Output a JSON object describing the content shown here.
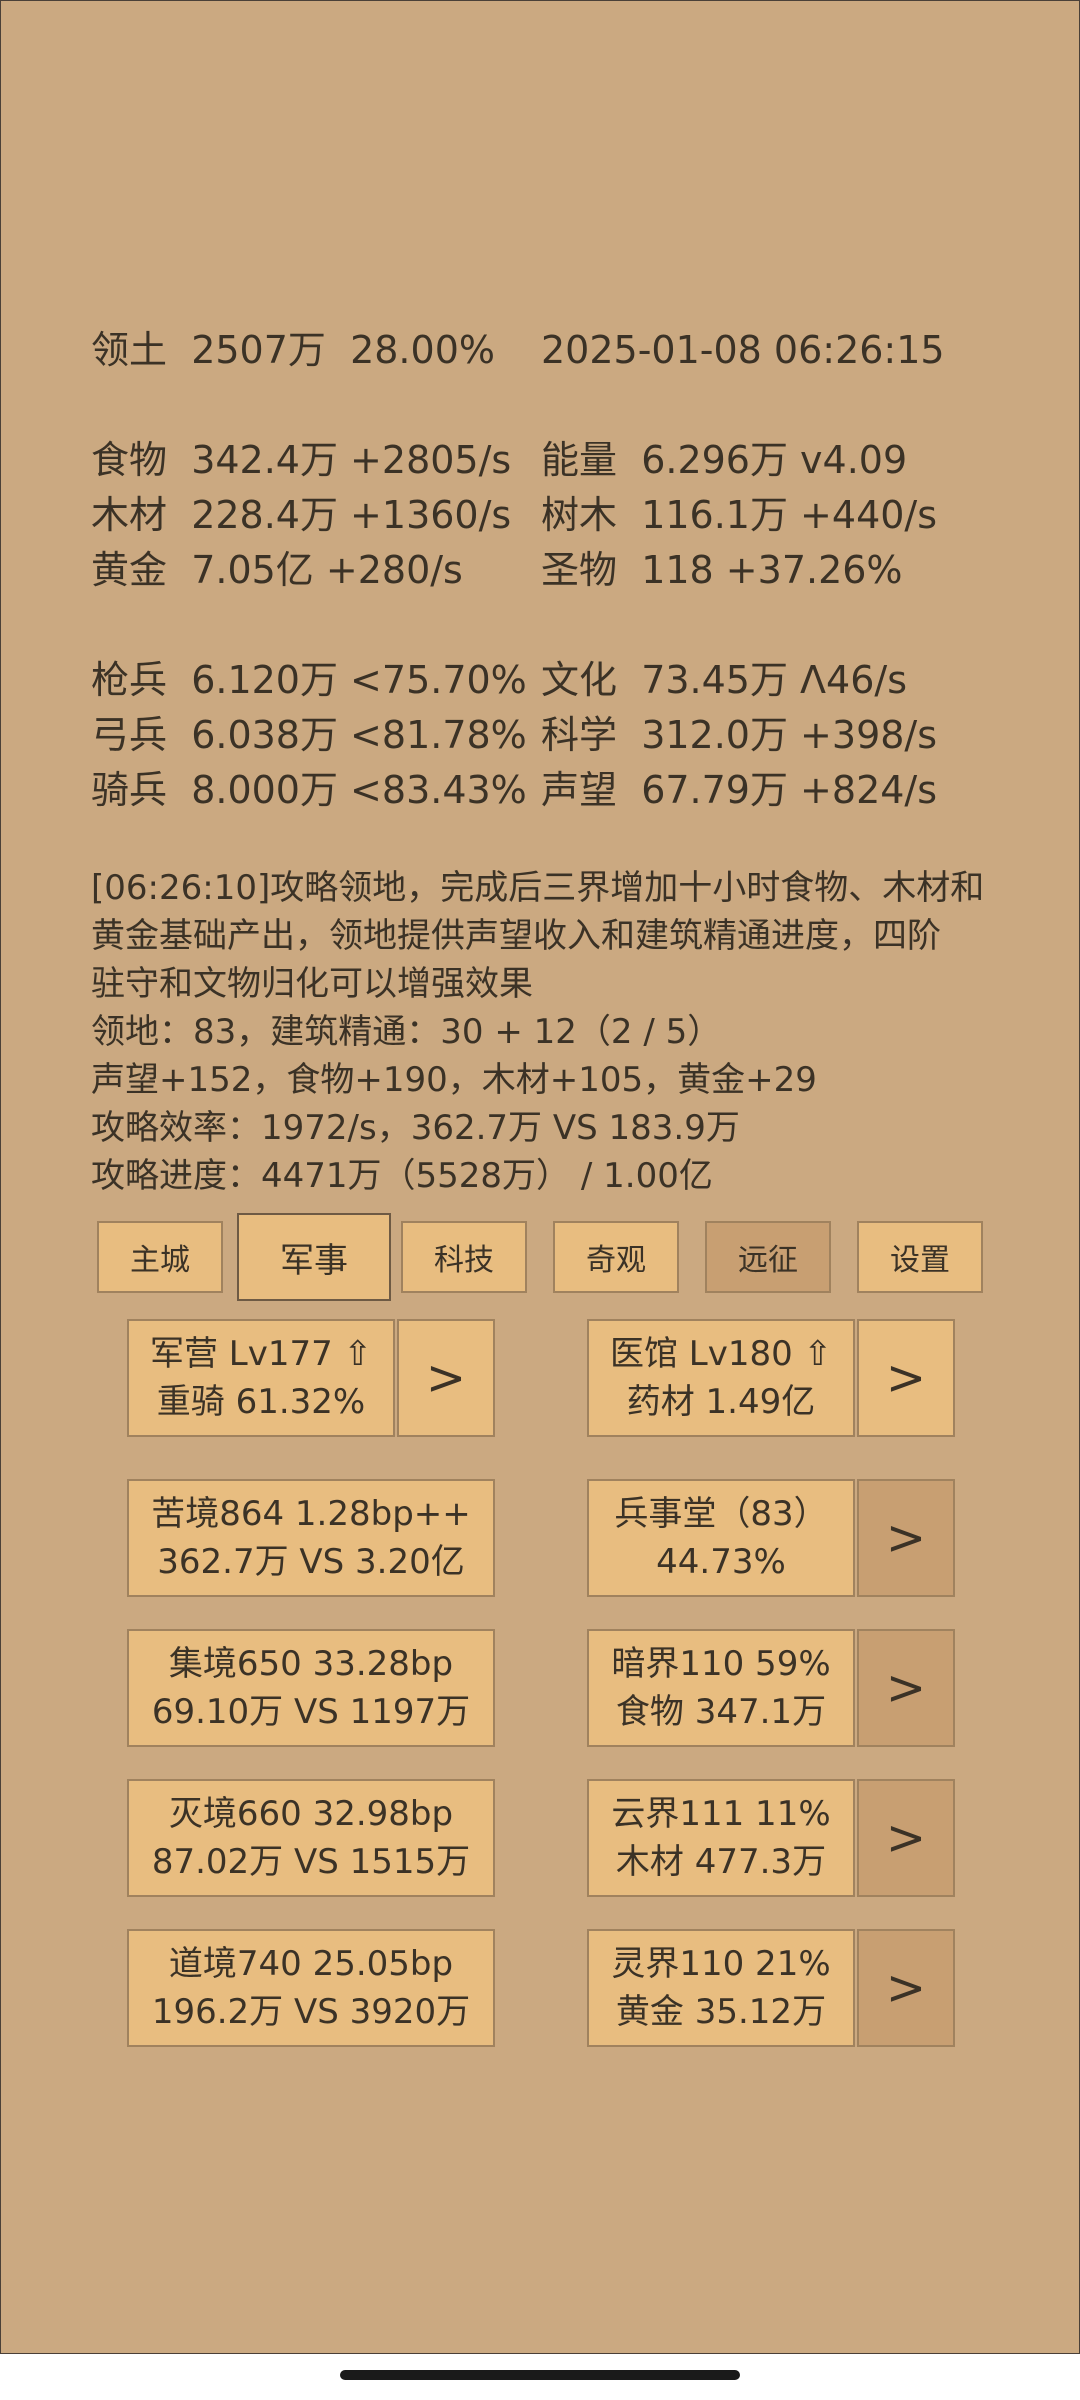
{
  "stats": {
    "territory": {
      "label": "领土",
      "value": "2507万",
      "pct": "28.00%"
    },
    "datetime": "2025-01-08 06:26:15",
    "left": [
      {
        "label": "食物",
        "value": "342.4万 +2805/s"
      },
      {
        "label": "木材",
        "value": "228.4万 +1360/s"
      },
      {
        "label": "黄金",
        "value": "7.05亿 +280/s"
      }
    ],
    "right": [
      {
        "label": "能量",
        "value": "6.296万  v4.09"
      },
      {
        "label": "树木",
        "value": "116.1万 +440/s"
      },
      {
        "label": "圣物",
        "value": "118 +37.26%"
      }
    ],
    "units": [
      {
        "label": "枪兵",
        "value": "6.120万 <75.70%"
      },
      {
        "label": "弓兵",
        "value": "6.038万 <81.78%"
      },
      {
        "label": "骑兵",
        "value": "8.000万 <83.43%"
      }
    ],
    "culture": [
      {
        "label": "文化",
        "value": "73.45万 Λ46/s"
      },
      {
        "label": "科学",
        "value": "312.0万 +398/s"
      },
      {
        "label": "声望",
        "value": "67.79万 +824/s"
      }
    ]
  },
  "message": {
    "lines": [
      "[06:26:10]攻略领地，完成后三界增加十小时食物、木材和",
      "黄金基础产出，领地提供声望收入和建筑精通进度，四阶",
      "驻守和文物归化可以增强效果",
      "领地：83，建筑精通：30 + 12（2 / 5）",
      "声望+152，食物+190，木材+105，黄金+29",
      "攻略效率：1972/s，362.7万 VS 183.9万",
      "攻略进度：4471万（5528万） / 1.00亿"
    ]
  },
  "tabs": [
    "主城",
    "军事",
    "科技",
    "奇观",
    "远征",
    "设置"
  ],
  "cards": {
    "barracks": {
      "line1": "军营 Lv177 ⇧",
      "line2": "重骑 61.32%"
    },
    "hospital": {
      "line1": "医馆 Lv180 ⇧",
      "line2": "药材 1.49亿"
    },
    "realms_left": [
      {
        "line1": "苦境864  1.28bp++",
        "line2": "362.7万 VS 3.20亿"
      },
      {
        "line1": "集境650  33.28bp",
        "line2": "69.10万 VS 1197万"
      },
      {
        "line1": "灭境660  32.98bp",
        "line2": "87.02万 VS 1515万"
      },
      {
        "line1": "道境740  25.05bp",
        "line2": "196.2万 VS 3920万"
      }
    ],
    "realms_right": [
      {
        "line1": "兵事堂（83）",
        "line2": "44.73%"
      },
      {
        "line1": "暗界110  59%",
        "line2": "食物 347.1万"
      },
      {
        "line1": "云界111  11%",
        "line2": "木材 477.3万"
      },
      {
        "line1": "灵界110  21%",
        "line2": "黄金 35.12万"
      }
    ],
    "go_label": ">"
  }
}
